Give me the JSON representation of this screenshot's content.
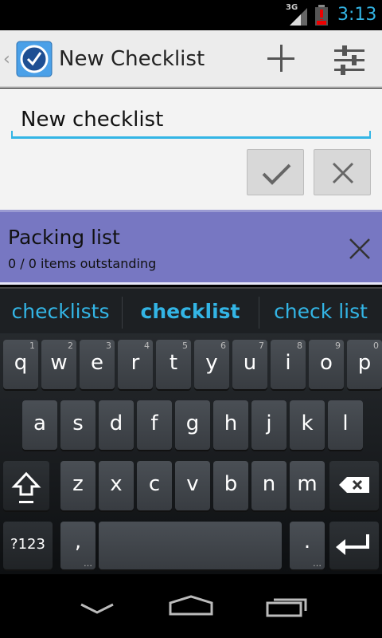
{
  "status_bar": {
    "network": "3G",
    "time": "3:13"
  },
  "action_bar": {
    "title": "New Checklist",
    "add_icon": "plus-icon",
    "settings_icon": "sliders-icon"
  },
  "editor": {
    "input_value": "New checklist",
    "confirm_icon": "check-icon",
    "cancel_icon": "close-icon"
  },
  "list": {
    "items": [
      {
        "name": "Packing list",
        "subtitle": "0 / 0 items outstanding"
      }
    ]
  },
  "keyboard": {
    "suggestions": [
      "checklists",
      "checklist",
      "check list"
    ],
    "row1": [
      {
        "c": "q",
        "h": "1"
      },
      {
        "c": "w",
        "h": "2"
      },
      {
        "c": "e",
        "h": "3"
      },
      {
        "c": "r",
        "h": "4"
      },
      {
        "c": "t",
        "h": "5"
      },
      {
        "c": "y",
        "h": "6"
      },
      {
        "c": "u",
        "h": "7"
      },
      {
        "c": "i",
        "h": "8"
      },
      {
        "c": "o",
        "h": "9"
      },
      {
        "c": "p",
        "h": "0"
      }
    ],
    "row2": [
      "a",
      "s",
      "d",
      "f",
      "g",
      "h",
      "j",
      "k",
      "l"
    ],
    "row3": [
      "z",
      "x",
      "c",
      "v",
      "b",
      "n",
      "m"
    ],
    "sym_label": "?123",
    "comma": ",",
    "period": ".",
    "ellipsis": "…"
  },
  "colors": {
    "accent": "#33b5e5",
    "list_item_bg": "#7777c2"
  }
}
